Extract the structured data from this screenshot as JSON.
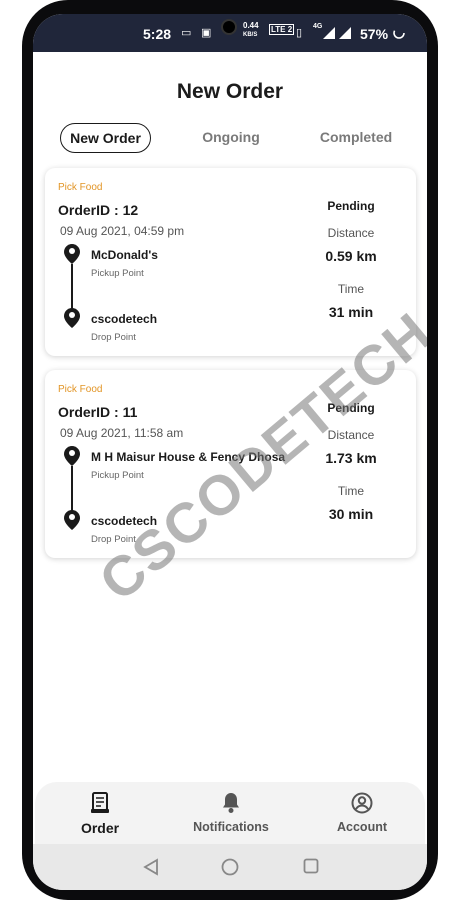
{
  "status_bar": {
    "time": "5:28",
    "net_speed": "0.44",
    "net_unit": "KB/S",
    "carrier": "LTE 2",
    "network": "4G",
    "battery": "57%"
  },
  "header": {
    "title": "New Order"
  },
  "tabs": [
    {
      "label": "New Order",
      "active": true
    },
    {
      "label": "Ongoing",
      "active": false
    },
    {
      "label": "Completed",
      "active": false
    }
  ],
  "orders": [
    {
      "tag": "Pick Food",
      "order_id": "OrderID : 12",
      "date": "09 Aug 2021, 04:59 pm",
      "pickup_name": "McDonald's",
      "pickup_label": "Pickup Point",
      "drop_name": "cscodetech",
      "drop_label": "Drop Point",
      "status": "Pending",
      "distance_label": "Distance",
      "distance": "0.59 km",
      "time_label": "Time",
      "time": "31 min"
    },
    {
      "tag": "Pick Food",
      "order_id": "OrderID : 11",
      "date": "09 Aug 2021, 11:58 am",
      "pickup_name": "M H Maisur House & Fency Dhosa",
      "pickup_label": "Pickup Point",
      "drop_name": "cscodetech",
      "drop_label": "Drop Point",
      "status": "Pending",
      "distance_label": "Distance",
      "distance": "1.73 km",
      "time_label": "Time",
      "time": "30 min"
    }
  ],
  "watermark": "CSCODETECH",
  "bottom_nav": [
    {
      "label": "Order",
      "icon": "order-receipt-icon",
      "active": true
    },
    {
      "label": "Notifications",
      "icon": "bell-icon",
      "active": false
    },
    {
      "label": "Account",
      "icon": "account-icon",
      "active": false
    }
  ],
  "colors": {
    "accent_tag": "#e29526",
    "status_bar": "#20263a"
  }
}
